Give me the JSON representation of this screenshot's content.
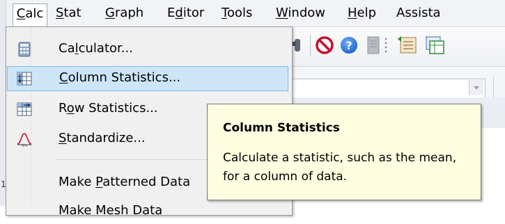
{
  "menubar": {
    "items": [
      {
        "label_pre": "",
        "label_u": "C",
        "label_post": "alc"
      },
      {
        "label_pre": "",
        "label_u": "S",
        "label_post": "tat"
      },
      {
        "label_pre": "",
        "label_u": "G",
        "label_post": "raph"
      },
      {
        "label_pre": "E",
        "label_u": "d",
        "label_post": "itor"
      },
      {
        "label_pre": "",
        "label_u": "T",
        "label_post": "ools"
      },
      {
        "label_pre": "",
        "label_u": "W",
        "label_post": "indow"
      },
      {
        "label_pre": "",
        "label_u": "H",
        "label_post": "elp"
      },
      {
        "label_pre": "Assista",
        "label_u": "",
        "label_post": ""
      }
    ]
  },
  "toolbar": {
    "icons": [
      "binoculars-icon",
      "no-entry-icon",
      "help-icon",
      "document-icon",
      "toolbar-grip-icon",
      "worksheet-icon",
      "multi-sheet-icon"
    ]
  },
  "calc_menu": {
    "items": [
      {
        "pre": "Ca",
        "u": "l",
        "post": "culator...",
        "icon": "calculator-icon"
      },
      {
        "pre": "",
        "u": "C",
        "post": "olumn Statistics...",
        "icon": "column-statistics-icon",
        "highlighted": true
      },
      {
        "pre": "R",
        "u": "o",
        "post": "w Statistics...",
        "icon": "row-statistics-icon"
      },
      {
        "pre": "",
        "u": "S",
        "post": "tandardize...",
        "icon": "standardize-icon"
      },
      {
        "pre": "Make ",
        "u": "P",
        "post": "atterned Data",
        "icon": ""
      },
      {
        "pre": "Make Mesh Data",
        "u": "",
        "post": "",
        "icon": ""
      }
    ]
  },
  "tooltip": {
    "title": "Column Statistics",
    "body": "Calculate a statistic, such as the mean, for a column of data."
  },
  "worksheet": {
    "row_label": "1"
  },
  "colors": {
    "highlight_bg": "#cde6f7",
    "highlight_border": "#80bbe8",
    "tooltip_bg": "#fffee0",
    "menu_bg": "#f0f0f0"
  }
}
